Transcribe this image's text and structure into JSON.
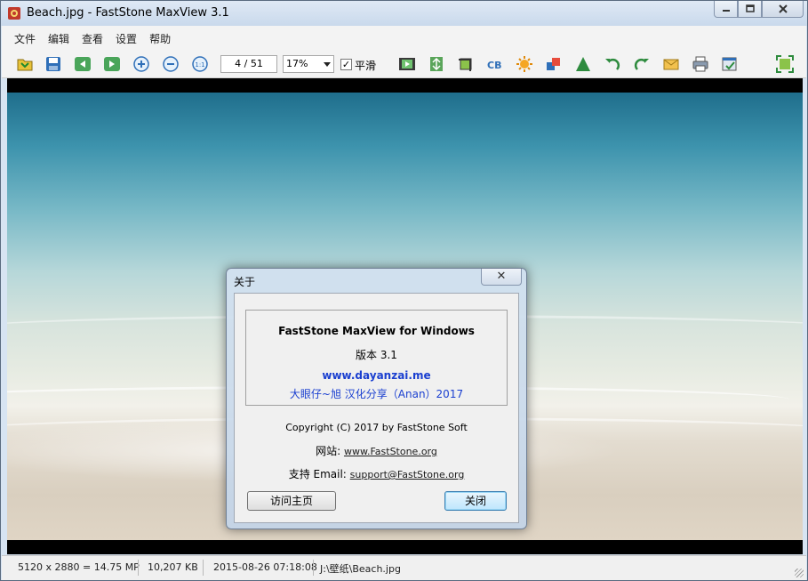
{
  "window": {
    "title": "Beach.jpg - FastStone MaxView 3.1",
    "minimize_icon": "minimize-icon",
    "maximize_icon": "maximize-icon",
    "close_icon": "close-icon"
  },
  "menu": [
    "文件",
    "编辑",
    "查看",
    "设置",
    "帮助"
  ],
  "toolbar": {
    "page_indicator": "4 / 51",
    "zoom_value": "17%",
    "smooth_checked": true,
    "smooth_label": "平滑",
    "left_icons": [
      "open-folder-icon",
      "save-icon",
      "previous-icon",
      "next-icon",
      "zoom-in-icon",
      "zoom-out-icon",
      "actual-size-icon"
    ],
    "right_icons": [
      "slideshow-icon",
      "resize-icon",
      "crop-icon",
      "color-balance-icon",
      "brightness-icon",
      "color-depth-icon",
      "sharpen-icon",
      "rotate-left-icon",
      "rotate-right-icon",
      "email-icon",
      "print-icon",
      "edit-tools-icon",
      "fullscreen-icon"
    ]
  },
  "image": {
    "description_colors": {
      "sea": "#3d93ad",
      "foam": "#e6ebe2",
      "sand": "#d9cfbf"
    }
  },
  "status": {
    "dimensions": "5120 x 2880 = 14.75 MP",
    "file_size": "10,207 KB",
    "date": "2015-08-26 07:18:08",
    "path": "J:\\壁纸\\Beach.jpg"
  },
  "about": {
    "title": "关于",
    "product": "FastStone MaxView for Windows",
    "version": "版本 3.1",
    "site": "www.dayanzai.me",
    "credit": "大眼仔~旭 汉化分享（Anan）2017",
    "copyright": "Copyright (C) 2017 by FastStone Soft",
    "website_label": "网站:",
    "website_url": "www.FastStone.org",
    "support_label": "支持 Email:",
    "support_email": "support@FastStone.org",
    "visit_button": "访问主页",
    "close_button": "关闭"
  },
  "colors": {
    "accent_blue": "#1a3fd0",
    "title_bar": "#c9d9ec"
  }
}
